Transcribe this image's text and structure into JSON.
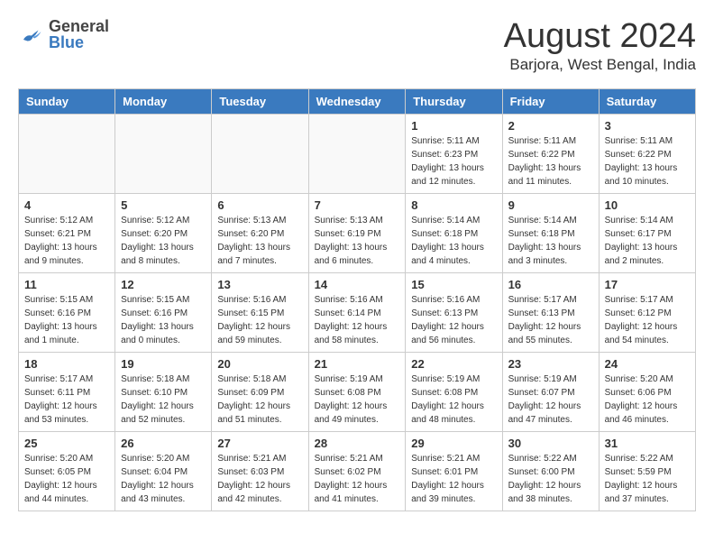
{
  "header": {
    "logo_general": "General",
    "logo_blue": "Blue",
    "month_title": "August 2024",
    "location": "Barjora, West Bengal, India"
  },
  "days_of_week": [
    "Sunday",
    "Monday",
    "Tuesday",
    "Wednesday",
    "Thursday",
    "Friday",
    "Saturday"
  ],
  "weeks": [
    [
      {
        "day": "",
        "info": ""
      },
      {
        "day": "",
        "info": ""
      },
      {
        "day": "",
        "info": ""
      },
      {
        "day": "",
        "info": ""
      },
      {
        "day": "1",
        "info": "Sunrise: 5:11 AM\nSunset: 6:23 PM\nDaylight: 13 hours\nand 12 minutes."
      },
      {
        "day": "2",
        "info": "Sunrise: 5:11 AM\nSunset: 6:22 PM\nDaylight: 13 hours\nand 11 minutes."
      },
      {
        "day": "3",
        "info": "Sunrise: 5:11 AM\nSunset: 6:22 PM\nDaylight: 13 hours\nand 10 minutes."
      }
    ],
    [
      {
        "day": "4",
        "info": "Sunrise: 5:12 AM\nSunset: 6:21 PM\nDaylight: 13 hours\nand 9 minutes."
      },
      {
        "day": "5",
        "info": "Sunrise: 5:12 AM\nSunset: 6:20 PM\nDaylight: 13 hours\nand 8 minutes."
      },
      {
        "day": "6",
        "info": "Sunrise: 5:13 AM\nSunset: 6:20 PM\nDaylight: 13 hours\nand 7 minutes."
      },
      {
        "day": "7",
        "info": "Sunrise: 5:13 AM\nSunset: 6:19 PM\nDaylight: 13 hours\nand 6 minutes."
      },
      {
        "day": "8",
        "info": "Sunrise: 5:14 AM\nSunset: 6:18 PM\nDaylight: 13 hours\nand 4 minutes."
      },
      {
        "day": "9",
        "info": "Sunrise: 5:14 AM\nSunset: 6:18 PM\nDaylight: 13 hours\nand 3 minutes."
      },
      {
        "day": "10",
        "info": "Sunrise: 5:14 AM\nSunset: 6:17 PM\nDaylight: 13 hours\nand 2 minutes."
      }
    ],
    [
      {
        "day": "11",
        "info": "Sunrise: 5:15 AM\nSunset: 6:16 PM\nDaylight: 13 hours\nand 1 minute."
      },
      {
        "day": "12",
        "info": "Sunrise: 5:15 AM\nSunset: 6:16 PM\nDaylight: 13 hours\nand 0 minutes."
      },
      {
        "day": "13",
        "info": "Sunrise: 5:16 AM\nSunset: 6:15 PM\nDaylight: 12 hours\nand 59 minutes."
      },
      {
        "day": "14",
        "info": "Sunrise: 5:16 AM\nSunset: 6:14 PM\nDaylight: 12 hours\nand 58 minutes."
      },
      {
        "day": "15",
        "info": "Sunrise: 5:16 AM\nSunset: 6:13 PM\nDaylight: 12 hours\nand 56 minutes."
      },
      {
        "day": "16",
        "info": "Sunrise: 5:17 AM\nSunset: 6:13 PM\nDaylight: 12 hours\nand 55 minutes."
      },
      {
        "day": "17",
        "info": "Sunrise: 5:17 AM\nSunset: 6:12 PM\nDaylight: 12 hours\nand 54 minutes."
      }
    ],
    [
      {
        "day": "18",
        "info": "Sunrise: 5:17 AM\nSunset: 6:11 PM\nDaylight: 12 hours\nand 53 minutes."
      },
      {
        "day": "19",
        "info": "Sunrise: 5:18 AM\nSunset: 6:10 PM\nDaylight: 12 hours\nand 52 minutes."
      },
      {
        "day": "20",
        "info": "Sunrise: 5:18 AM\nSunset: 6:09 PM\nDaylight: 12 hours\nand 51 minutes."
      },
      {
        "day": "21",
        "info": "Sunrise: 5:19 AM\nSunset: 6:08 PM\nDaylight: 12 hours\nand 49 minutes."
      },
      {
        "day": "22",
        "info": "Sunrise: 5:19 AM\nSunset: 6:08 PM\nDaylight: 12 hours\nand 48 minutes."
      },
      {
        "day": "23",
        "info": "Sunrise: 5:19 AM\nSunset: 6:07 PM\nDaylight: 12 hours\nand 47 minutes."
      },
      {
        "day": "24",
        "info": "Sunrise: 5:20 AM\nSunset: 6:06 PM\nDaylight: 12 hours\nand 46 minutes."
      }
    ],
    [
      {
        "day": "25",
        "info": "Sunrise: 5:20 AM\nSunset: 6:05 PM\nDaylight: 12 hours\nand 44 minutes."
      },
      {
        "day": "26",
        "info": "Sunrise: 5:20 AM\nSunset: 6:04 PM\nDaylight: 12 hours\nand 43 minutes."
      },
      {
        "day": "27",
        "info": "Sunrise: 5:21 AM\nSunset: 6:03 PM\nDaylight: 12 hours\nand 42 minutes."
      },
      {
        "day": "28",
        "info": "Sunrise: 5:21 AM\nSunset: 6:02 PM\nDaylight: 12 hours\nand 41 minutes."
      },
      {
        "day": "29",
        "info": "Sunrise: 5:21 AM\nSunset: 6:01 PM\nDaylight: 12 hours\nand 39 minutes."
      },
      {
        "day": "30",
        "info": "Sunrise: 5:22 AM\nSunset: 6:00 PM\nDaylight: 12 hours\nand 38 minutes."
      },
      {
        "day": "31",
        "info": "Sunrise: 5:22 AM\nSunset: 5:59 PM\nDaylight: 12 hours\nand 37 minutes."
      }
    ]
  ]
}
